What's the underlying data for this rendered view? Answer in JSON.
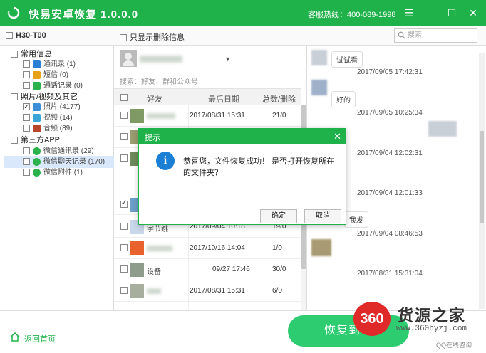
{
  "app": {
    "title": "快易安卓恢复  1.0.0.0",
    "hotline": "客服热线：400-089-1998",
    "brand_color": "#20b24a"
  },
  "window_controls": [
    "menu-icon",
    "minimize-icon",
    "maximize-icon",
    "close-icon"
  ],
  "device": {
    "label": "H30-T00"
  },
  "filter": {
    "only_deleted_label": "只显示删除信息"
  },
  "search": {
    "placeholder": "搜索"
  },
  "sidebar": {
    "categories": [
      {
        "label": "常用信息",
        "children": [
          {
            "label": "通讯录 (1)",
            "icon": "contacts-icon",
            "color": "#2a7fd4",
            "checked": false
          },
          {
            "label": "短信 (0)",
            "icon": "sms-icon",
            "color": "#e8a21a",
            "checked": false
          },
          {
            "label": "通话记录 (0)",
            "icon": "call-log-icon",
            "color": "#2bb24c",
            "checked": false
          }
        ]
      },
      {
        "label": "照片/视频及其它",
        "children": [
          {
            "label": "照片 (4177)",
            "icon": "photo-icon",
            "color": "#3a8fd8",
            "checked": true
          },
          {
            "label": "视频 (14)",
            "icon": "video-icon",
            "color": "#3aa6d8",
            "checked": false
          },
          {
            "label": "音频 (89)",
            "icon": "audio-icon",
            "color": "#b7462c",
            "checked": false
          }
        ]
      },
      {
        "label": "第三方APP",
        "children": [
          {
            "label": "微信通讯录 (29)",
            "icon": "wechat-icon",
            "color": "#2bb24c",
            "checked": false
          },
          {
            "label": "微信聊天记录 (170)",
            "icon": "wechat-icon",
            "color": "#2bb24c",
            "checked": false,
            "selected": true
          },
          {
            "label": "微信附件 (1)",
            "icon": "wechat-icon",
            "color": "#2bb24c",
            "checked": false
          }
        ]
      }
    ]
  },
  "contacts": {
    "search_tip": "搜索：好友、群和公众号",
    "headers": {
      "friend": "好友",
      "last_date": "最后日期",
      "total_deleted": "总数/删除"
    },
    "rows": [
      {
        "name": "",
        "date": "2017/08/31 15:31",
        "count": "21/0",
        "checked": false
      },
      {
        "name": "",
        "date": "",
        "count": "",
        "checked": false
      },
      {
        "name": "",
        "date": "",
        "count": "",
        "checked": false
      },
      {
        "name": "",
        "date": "",
        "count": "",
        "checked": true
      },
      {
        "name": "字节跳",
        "date": "2017/09/04 10:18",
        "count": "19/0",
        "checked": false
      },
      {
        "name": "",
        "date": "2017/10/16 14:04",
        "count": "1/0",
        "checked": false
      },
      {
        "name": "设备",
        "date": "09/27 17:46",
        "count": "30/0",
        "checked": false
      },
      {
        "name": "",
        "date": "2017/08/31 15:31",
        "count": "6/0",
        "checked": false
      }
    ]
  },
  "chat": {
    "messages": [
      {
        "text": "试试看"
      },
      {
        "text": "好的"
      },
      {
        "text": "我发"
      }
    ],
    "timestamps": [
      "2017/09/05 17:42:31",
      "2017/09/05 10:25:34",
      "2017/09/04 12:02:31",
      "2017/09/04 12:01:33",
      "2017/09/04 08:46:53",
      "2017/08/31 15:31:04"
    ]
  },
  "dialog": {
    "title": "提示",
    "message": "恭喜您，文件恢复成功！ 是否打开恢复所在的文件夹？",
    "ok_label": "确定",
    "cancel_label": "取消"
  },
  "bottom": {
    "home_label": "返回首页",
    "recover_label": "恢复到电"
  },
  "watermark": {
    "badge": "360",
    "name": "货源之家",
    "url": "www.360hyzj.com",
    "qq": "QQ在线咨询"
  }
}
